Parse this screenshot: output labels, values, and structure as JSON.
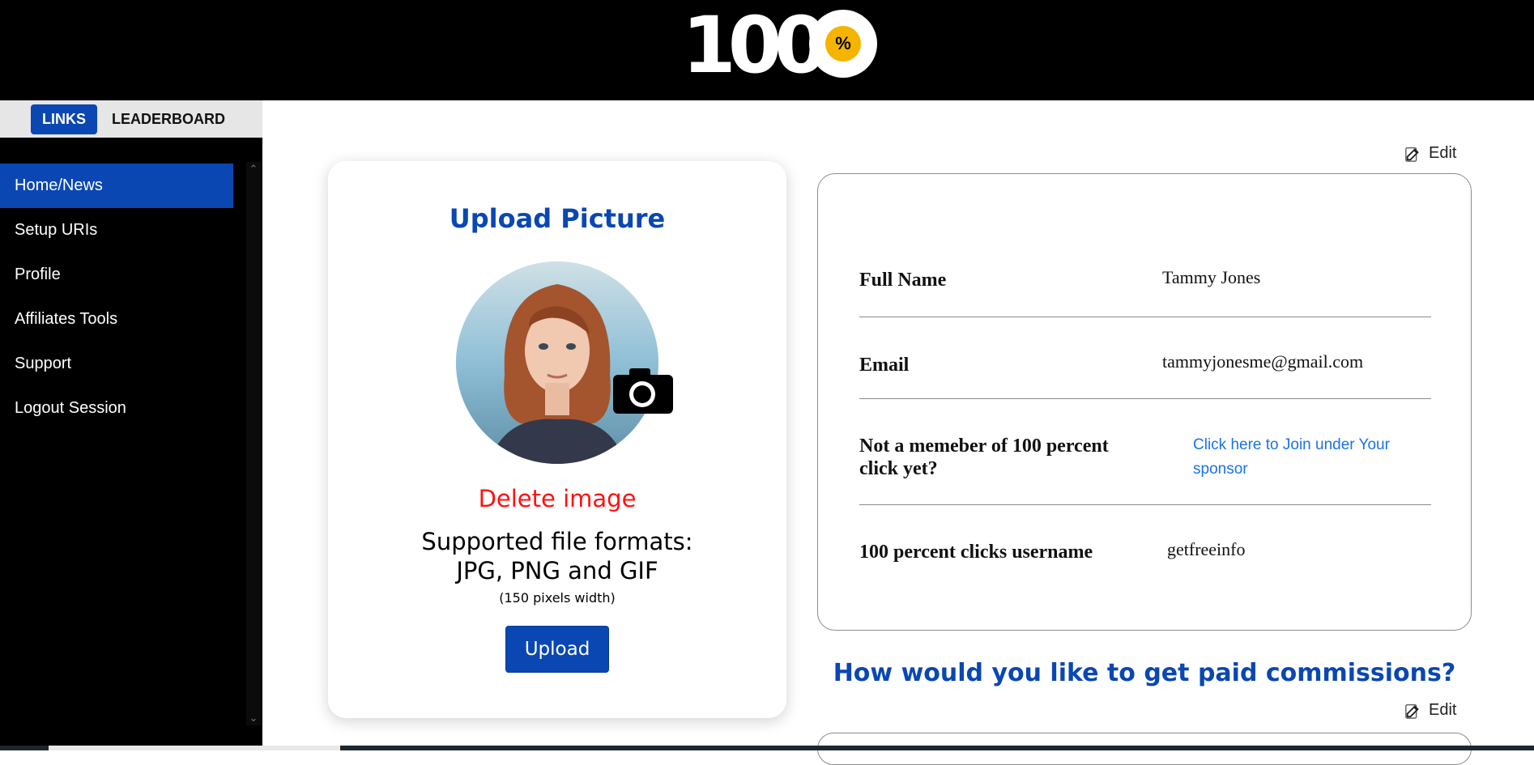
{
  "header": {
    "logo_text": "100",
    "logo_badge_glyph": "%"
  },
  "sidebar": {
    "tabs": [
      {
        "label": "LINKS",
        "active": true
      },
      {
        "label": "LEADERBOARD",
        "active": false
      }
    ],
    "items": [
      {
        "label": "Home/News",
        "active": true
      },
      {
        "label": "Setup URIs"
      },
      {
        "label": "Profile"
      },
      {
        "label": "Affiliates Tools"
      },
      {
        "label": "Support"
      },
      {
        "label": "Logout Session"
      }
    ]
  },
  "upload_card": {
    "title": "Upload Picture",
    "delete_label": "Delete image",
    "formats_line1": "Supported file formats:",
    "formats_line2": "JPG, PNG and GIF",
    "note": "(150 pixels width)",
    "upload_label": "Upload"
  },
  "profile": {
    "edit_label": "Edit",
    "rows": [
      {
        "label": "Full Name",
        "value": "Tammy Jones"
      },
      {
        "label": "Email",
        "value": "tammyjonesme@gmail.com"
      },
      {
        "label": "Not a memeber of 100 percent click yet?",
        "link": "Click here to Join under Your sponsor"
      },
      {
        "label": "100 percent clicks username",
        "value": "getfreeinfo"
      }
    ]
  },
  "commissions": {
    "title": "How would you like to get paid commissions?",
    "edit_label": "Edit"
  },
  "colors": {
    "brand_blue": "#0a47b3",
    "delete_red": "#ff1010",
    "link_blue": "#1a73e8",
    "badge_gold": "#f5b400"
  }
}
